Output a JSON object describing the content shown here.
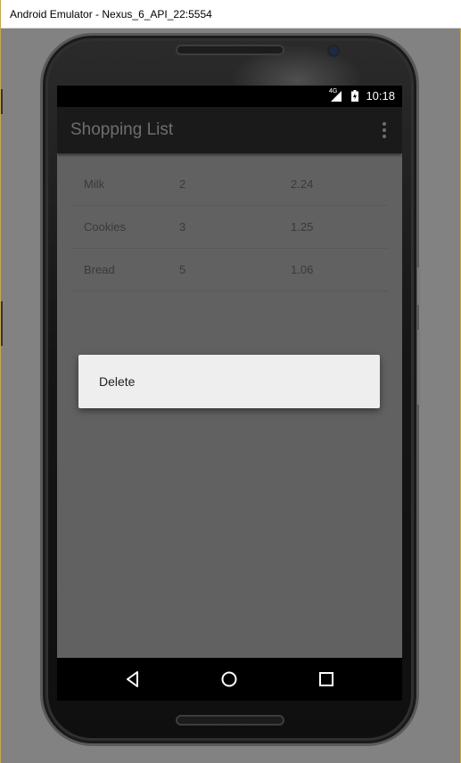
{
  "window": {
    "title": "Android Emulator - Nexus_6_API_22:5554"
  },
  "status_bar": {
    "network": "4G",
    "time": "10:18",
    "icons": [
      "signal-icon",
      "battery-icon"
    ]
  },
  "app_bar": {
    "title": "Shopping List",
    "overflow_icon": "overflow-menu-icon"
  },
  "list": {
    "rows": [
      {
        "name": "Milk",
        "quantity": "2",
        "price": "2.24"
      },
      {
        "name": "Cookies",
        "quantity": "3",
        "price": "1.25"
      },
      {
        "name": "Bread",
        "quantity": "5",
        "price": "1.06"
      }
    ]
  },
  "context_menu": {
    "items": [
      {
        "label": "Delete"
      }
    ]
  },
  "nav_bar": {
    "icons": [
      "back-icon",
      "home-icon",
      "recents-icon"
    ]
  },
  "colors": {
    "content_background": "#616161",
    "app_bar": "#1a1a1a",
    "menu_background": "#eeeeee"
  }
}
